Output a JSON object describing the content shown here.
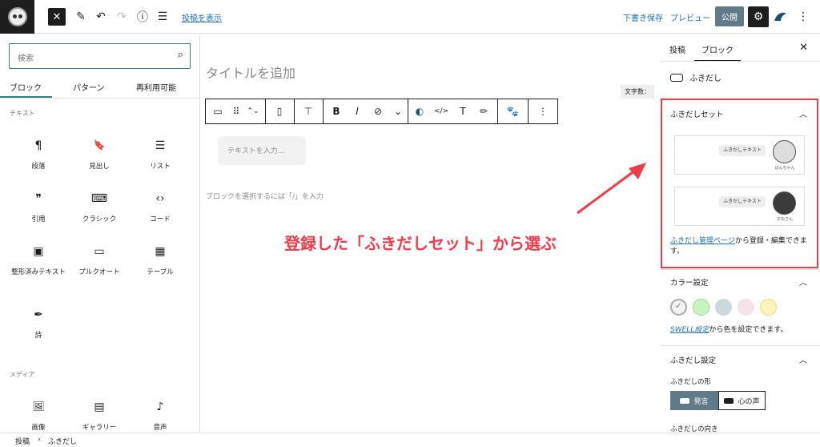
{
  "topbar": {
    "close": "✕",
    "pen": "✎",
    "undo": "↶",
    "redo": "↷",
    "info": "ⓘ",
    "list": "☰",
    "view_post": "投稿を表示",
    "draft": "下書き保存",
    "preview": "プレビュー",
    "publish": "公開",
    "settings": "⚙",
    "more": "⋮"
  },
  "left": {
    "search_placeholder": "検索",
    "search_icon": "⌕",
    "tabs": [
      "ブロック",
      "パターン",
      "再利用可能"
    ],
    "cat_text": "テキスト",
    "cat_media": "メディア",
    "blocks": [
      {
        "icon": "¶",
        "label": "段落"
      },
      {
        "icon": "🔖",
        "label": "見出し"
      },
      {
        "icon": "☰",
        "label": "リスト"
      },
      {
        "icon": "❞",
        "label": "引用"
      },
      {
        "icon": "⌨",
        "label": "クラシック"
      },
      {
        "icon": "‹›",
        "label": "コード"
      },
      {
        "icon": "▣",
        "label": "整形済みテキスト"
      },
      {
        "icon": "▭",
        "label": "プルクオート"
      },
      {
        "icon": "▦",
        "label": "テーブル"
      },
      {
        "icon": "✒",
        "label": "詩"
      }
    ],
    "media": [
      {
        "icon": "🖼",
        "label": "画像"
      },
      {
        "icon": "▤",
        "label": "ギャラリー"
      },
      {
        "icon": "♪",
        "label": "音声"
      }
    ]
  },
  "editor": {
    "title_placeholder": "タイトルを追加",
    "word_count": "文字数：",
    "fuki_placeholder": "テキストを入力…",
    "hint": "ブロックを選択するには「/」を入力",
    "annotation": "登録した「ふきだしセット」から選ぶ",
    "toolbar": [
      "▭",
      "⠿",
      "⌃⌄",
      "▯",
      "⊤",
      "B",
      "I",
      "⊘",
      "⌄",
      "◐",
      "</>",
      "T",
      "✏",
      "🐾",
      "⋮"
    ]
  },
  "right": {
    "tabs": [
      "投稿",
      "ブロック"
    ],
    "close": "✕",
    "block_name": "ふきだし",
    "fuki_set": "ふきだしセット",
    "bubble_text": "ふきだしテキスト",
    "preset_names": [
      "ぱんちゃん",
      "子ねさん"
    ],
    "link": "ふきだし管理ページ",
    "link_tail": "から登録・編集できます。",
    "color_settings": "カラー設定",
    "colors": [
      "#f2f2f2",
      "#c8f2c0",
      "#c9d9dc",
      "#f4e4ea",
      "#fbf2bc"
    ],
    "swell_link": "SWELL設定",
    "swell_tail": "から色を設定できます。",
    "fuki_settings": "ふきだし設定",
    "shape_label": "ふきだしの形",
    "shape_options": [
      "発言",
      "心の声"
    ],
    "direction": "ふきだしの向き"
  },
  "breadcrumb": [
    "投稿",
    "ふきだし"
  ]
}
